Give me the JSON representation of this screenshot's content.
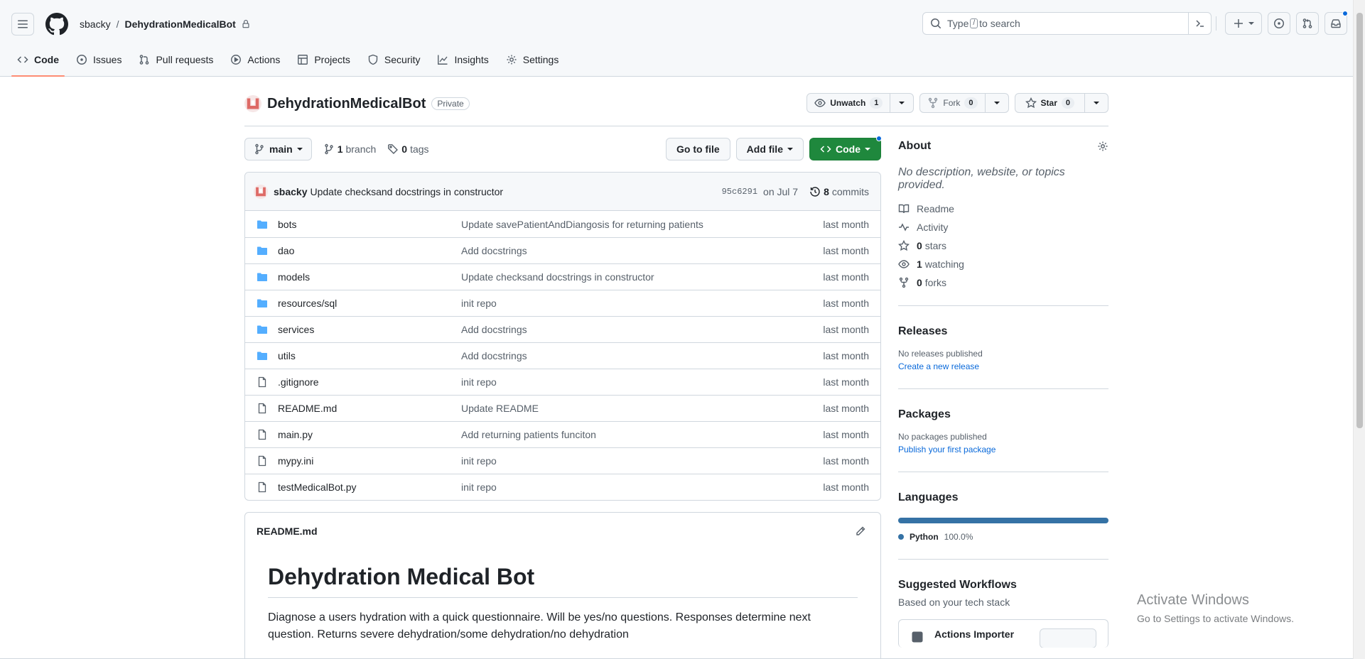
{
  "header": {
    "owner": "sbacky",
    "separator": "/",
    "repo": "DehydrationMedicalBot",
    "search_before": "Type",
    "search_kbd": "/",
    "search_after": "to search"
  },
  "tabs": [
    {
      "label": "Code",
      "icon": "code-icon",
      "active": true
    },
    {
      "label": "Issues",
      "icon": "issue-icon"
    },
    {
      "label": "Pull requests",
      "icon": "pull-request-icon"
    },
    {
      "label": "Actions",
      "icon": "play-icon"
    },
    {
      "label": "Projects",
      "icon": "table-icon"
    },
    {
      "label": "Security",
      "icon": "shield-icon"
    },
    {
      "label": "Insights",
      "icon": "graph-icon"
    },
    {
      "label": "Settings",
      "icon": "gear-icon"
    }
  ],
  "repo": {
    "name": "DehydrationMedicalBot",
    "visibility": "Private",
    "unwatch_label": "Unwatch",
    "watch_count": "1",
    "fork_label": "Fork",
    "fork_count": "0",
    "star_label": "Star",
    "star_count": "0"
  },
  "toolbar": {
    "branch": "main",
    "branch_count": "1",
    "branch_label": "branch",
    "tag_count": "0",
    "tag_label": "tags",
    "go_to_file": "Go to file",
    "add_file": "Add file",
    "code": "Code"
  },
  "commit": {
    "author": "sbacky",
    "message": "Update checksand docstrings in constructor",
    "sha": "95c6291",
    "date": "on Jul 7",
    "count": "8",
    "count_label": "commits"
  },
  "files": [
    {
      "type": "dir",
      "name": "bots",
      "message": "Update savePatientAndDiangosis for returning patients",
      "age": "last month"
    },
    {
      "type": "dir",
      "name": "dao",
      "message": "Add docstrings",
      "age": "last month"
    },
    {
      "type": "dir",
      "name": "models",
      "message": "Update checksand docstrings in constructor",
      "age": "last month"
    },
    {
      "type": "dir",
      "name": "resources/sql",
      "message": "init repo",
      "age": "last month"
    },
    {
      "type": "dir",
      "name": "services",
      "message": "Add docstrings",
      "age": "last month"
    },
    {
      "type": "dir",
      "name": "utils",
      "message": "Add docstrings",
      "age": "last month"
    },
    {
      "type": "file",
      "name": ".gitignore",
      "message": "init repo",
      "age": "last month"
    },
    {
      "type": "file",
      "name": "README.md",
      "message": "Update README",
      "age": "last month"
    },
    {
      "type": "file",
      "name": "main.py",
      "message": "Add returning patients funciton",
      "age": "last month"
    },
    {
      "type": "file",
      "name": "mypy.ini",
      "message": "init repo",
      "age": "last month"
    },
    {
      "type": "file",
      "name": "testMedicalBot.py",
      "message": "init repo",
      "age": "last month"
    }
  ],
  "readme": {
    "filename": "README.md",
    "title": "Dehydration Medical Bot",
    "body": "Diagnose a users hydration with a quick questionnaire. Will be yes/no questions. Responses determine next question. Returns severe dehydration/some dehydration/no dehydration"
  },
  "about": {
    "heading": "About",
    "description": "No description, website, or topics provided.",
    "readme": "Readme",
    "activity": "Activity",
    "stars_count": "0",
    "stars_label": "stars",
    "watching_count": "1",
    "watching_label": "watching",
    "forks_count": "0",
    "forks_label": "forks"
  },
  "releases": {
    "heading": "Releases",
    "note": "No releases published",
    "link": "Create a new release"
  },
  "packages": {
    "heading": "Packages",
    "note": "No packages published",
    "link": "Publish your first package"
  },
  "languages": {
    "heading": "Languages",
    "items": [
      {
        "name": "Python",
        "percent": "100.0%",
        "share": 1.0,
        "color": "#3572a5"
      }
    ]
  },
  "workflows": {
    "heading": "Suggested Workflows",
    "subheading": "Based on your tech stack",
    "first": "Actions Importer"
  },
  "watermark": {
    "line1": "Activate Windows",
    "line2": "Go to Settings to activate Windows."
  },
  "colors": {
    "accent": "#0969da",
    "green": "#1f883d",
    "tab_underline": "#fd8c73",
    "folder": "#54aeff"
  }
}
